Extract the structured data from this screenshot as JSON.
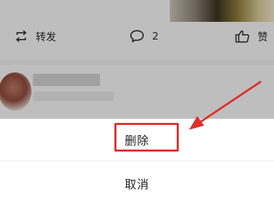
{
  "feed": {
    "actions": {
      "repost_label": "转发",
      "comment_count": "2",
      "like_label": "赞"
    }
  },
  "action_sheet": {
    "delete_label": "删除",
    "cancel_label": "取消"
  },
  "annotation": {
    "color": "#e0302a"
  }
}
